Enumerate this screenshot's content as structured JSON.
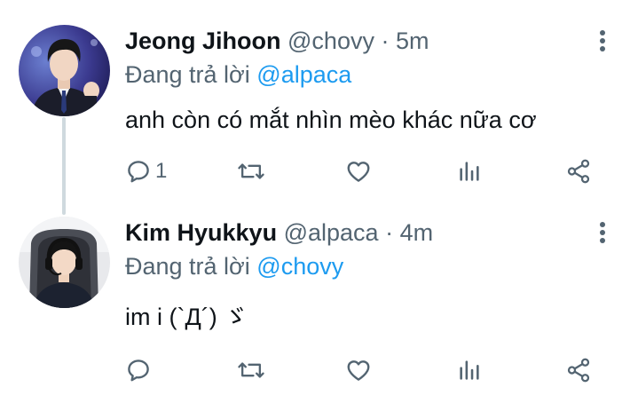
{
  "tweets": [
    {
      "display_name": "Jeong Jihoon",
      "handle": "@chovy",
      "separator": "·",
      "time": "5m",
      "reply_prefix": "Đang trả lời",
      "reply_to": "@alpaca",
      "text": "anh còn có mắt nhìn mèo khác nữa cơ",
      "reply_count": "1",
      "retweet_count": "",
      "like_count": ""
    },
    {
      "display_name": "Kim Hyukkyu",
      "handle": "@alpaca",
      "separator": "·",
      "time": "4m",
      "reply_prefix": "Đang trả lời",
      "reply_to": "@chovy",
      "text": "im i (`Д´) ゞ",
      "reply_count": "",
      "retweet_count": "",
      "like_count": ""
    }
  ],
  "icons": {
    "more": "more-vertical-icon",
    "reply": "reply-icon",
    "retweet": "retweet-icon",
    "like": "heart-icon",
    "views": "analytics-icon",
    "share": "share-icon"
  },
  "colors": {
    "link": "#1d9bf0",
    "secondary": "#536471",
    "text": "#0f1419",
    "thread_line": "#cfd9de"
  }
}
